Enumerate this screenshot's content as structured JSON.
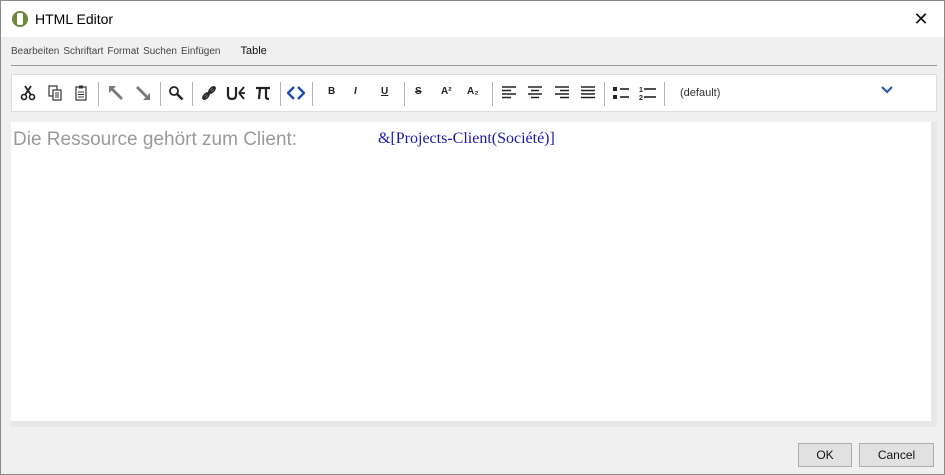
{
  "window": {
    "title": "HTML Editor",
    "close_symbol": "✕"
  },
  "menu": {
    "items": [
      "Bearbeiten",
      "Schriftart",
      "Format",
      "Suchen",
      "Einfügen"
    ],
    "active": "Table"
  },
  "toolbar": {
    "icons": [
      "cut-icon",
      "copy-icon",
      "paste-icon",
      "undo-icon",
      "redo-icon",
      "search-icon",
      "link-icon",
      "unlink-icon",
      "special-char-icon",
      "source-code-icon"
    ],
    "format": {
      "bold": "B",
      "italic": "I",
      "underline": "U",
      "strike": "S",
      "superscript": "A²",
      "subscript": "A₂"
    },
    "style_value": "(default)"
  },
  "editor": {
    "label_text": "Die Ressource gehört zum Client:",
    "field_text": "&[Projects-Client(Société)]"
  },
  "buttons": {
    "ok": "OK",
    "cancel": "Cancel"
  }
}
